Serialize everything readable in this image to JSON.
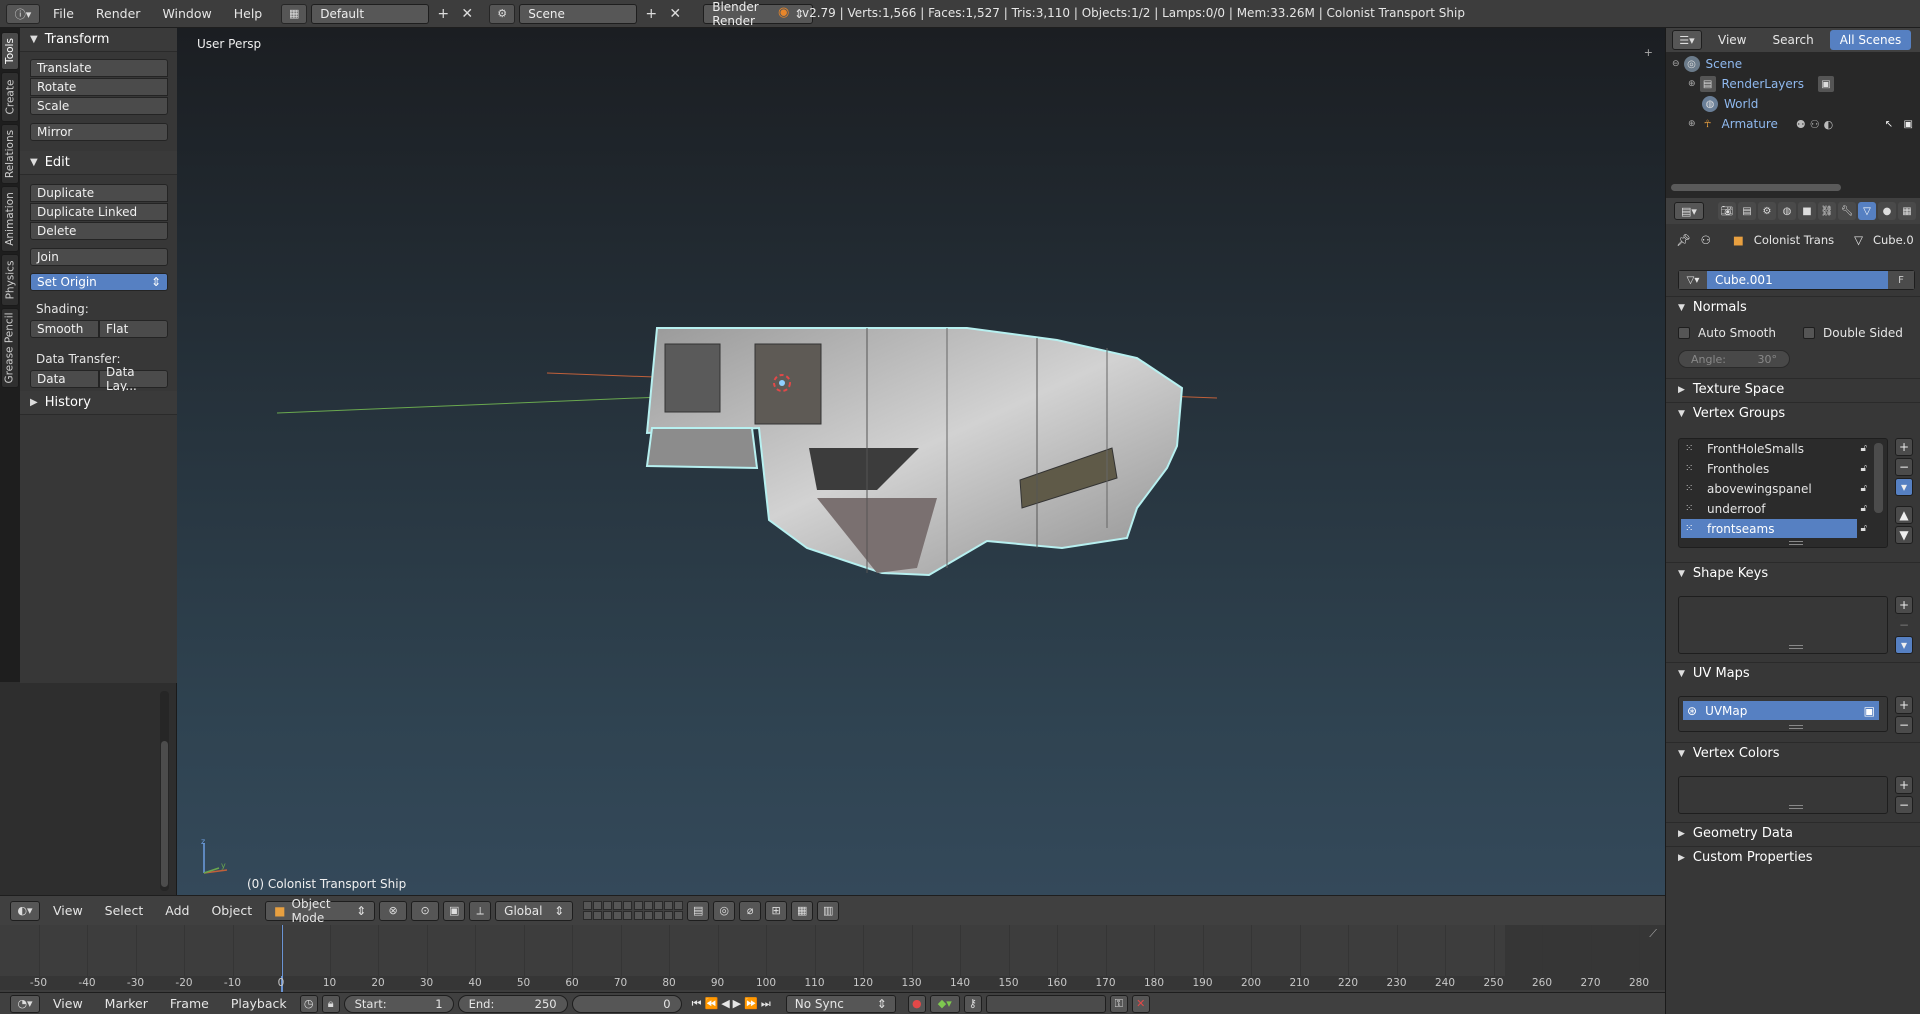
{
  "topbar": {
    "menus": [
      "File",
      "Render",
      "Window",
      "Help"
    ],
    "screen_layout": "Default",
    "scene": "Scene",
    "engine": "Blender Render",
    "stats": "v2.79 | Verts:1,566 | Faces:1,527 | Tris:3,110 | Objects:1/2 | Lamps:0/0 | Mem:33.26M | Colonist Transport Ship"
  },
  "tabs": [
    "Tools",
    "Create",
    "Relations",
    "Animation",
    "Physics",
    "Grease Pencil"
  ],
  "toolshelf": {
    "transform_title": "Transform",
    "translate": "Translate",
    "rotate": "Rotate",
    "scale": "Scale",
    "mirror": "Mirror",
    "edit_title": "Edit",
    "duplicate": "Duplicate",
    "duplicate_linked": "Duplicate Linked",
    "delete": "Delete",
    "join": "Join",
    "set_origin": "Set Origin",
    "shading_label": "Shading:",
    "smooth": "Smooth",
    "flat": "Flat",
    "data_transfer_label": "Data Transfer:",
    "data": "Data",
    "data_layout": "Data Lay...",
    "history_title": "History"
  },
  "viewport": {
    "view_label": "User Persp",
    "object_label": "(0) Colonist Transport Ship"
  },
  "vpheader": {
    "menus": [
      "View",
      "Select",
      "Add",
      "Object"
    ],
    "mode": "Object Mode",
    "orientation": "Global"
  },
  "timeline": {
    "ticks": [
      -50,
      -40,
      -30,
      -20,
      -10,
      0,
      10,
      20,
      30,
      40,
      50,
      60,
      70,
      80,
      90,
      100,
      110,
      120,
      130,
      140,
      150,
      160,
      170,
      180,
      190,
      200,
      210,
      220,
      230,
      240,
      250,
      260,
      270,
      280
    ],
    "menus": [
      "View",
      "Marker",
      "Frame",
      "Playback"
    ],
    "start_label": "Start:",
    "start_value": "1",
    "end_label": "End:",
    "end_value": "250",
    "current_frame": "0",
    "sync": "No Sync"
  },
  "outliner": {
    "tabs": [
      "View",
      "Search",
      "All Scenes"
    ],
    "items": [
      "Scene",
      "RenderLayers",
      "World",
      "Armature"
    ]
  },
  "properties": {
    "breadcrumb_object": "Colonist Trans",
    "breadcrumb_mesh": "Cube.0",
    "mesh_name": "Cube.001",
    "fake_user": "F",
    "normals_title": "Normals",
    "auto_smooth": "Auto Smooth",
    "double_sided": "Double Sided",
    "angle_label": "Angle:",
    "angle_value": "30°",
    "texture_space": "Texture Space",
    "vertex_groups_title": "Vertex Groups",
    "vertex_groups": [
      "FrontHoleSmalls",
      "Frontholes",
      "abovewingspanel",
      "underroof",
      "frontseams"
    ],
    "shape_keys": "Shape Keys",
    "uv_maps": "UV Maps",
    "uv_map_name": "UVMap",
    "vertex_colors": "Vertex Colors",
    "geometry_data": "Geometry Data",
    "custom_properties": "Custom Properties"
  },
  "colors": {
    "accent": "#5680c2",
    "x_axis": "#c0603a",
    "y_axis": "#6aa84f"
  }
}
